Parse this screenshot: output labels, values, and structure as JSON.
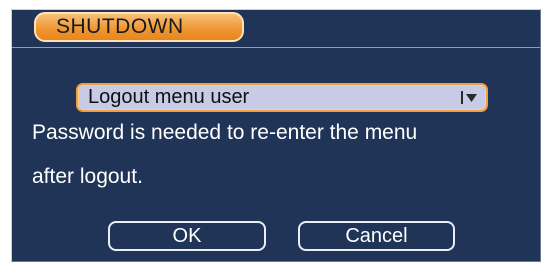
{
  "dialog": {
    "title": "SHUTDOWN",
    "select": {
      "value": "Logout menu user",
      "icon": "chevron-down-icon"
    },
    "message_line1": "Password is needed to re-enter the menu",
    "message_line2": "after logout.",
    "ok_label": "OK",
    "cancel_label": "Cancel"
  },
  "colors": {
    "panel": "#1f3456",
    "title_tab": "#ee9530",
    "select_bg": "#c8cbe5",
    "select_border": "#f0a040",
    "text": "#ffffff"
  }
}
